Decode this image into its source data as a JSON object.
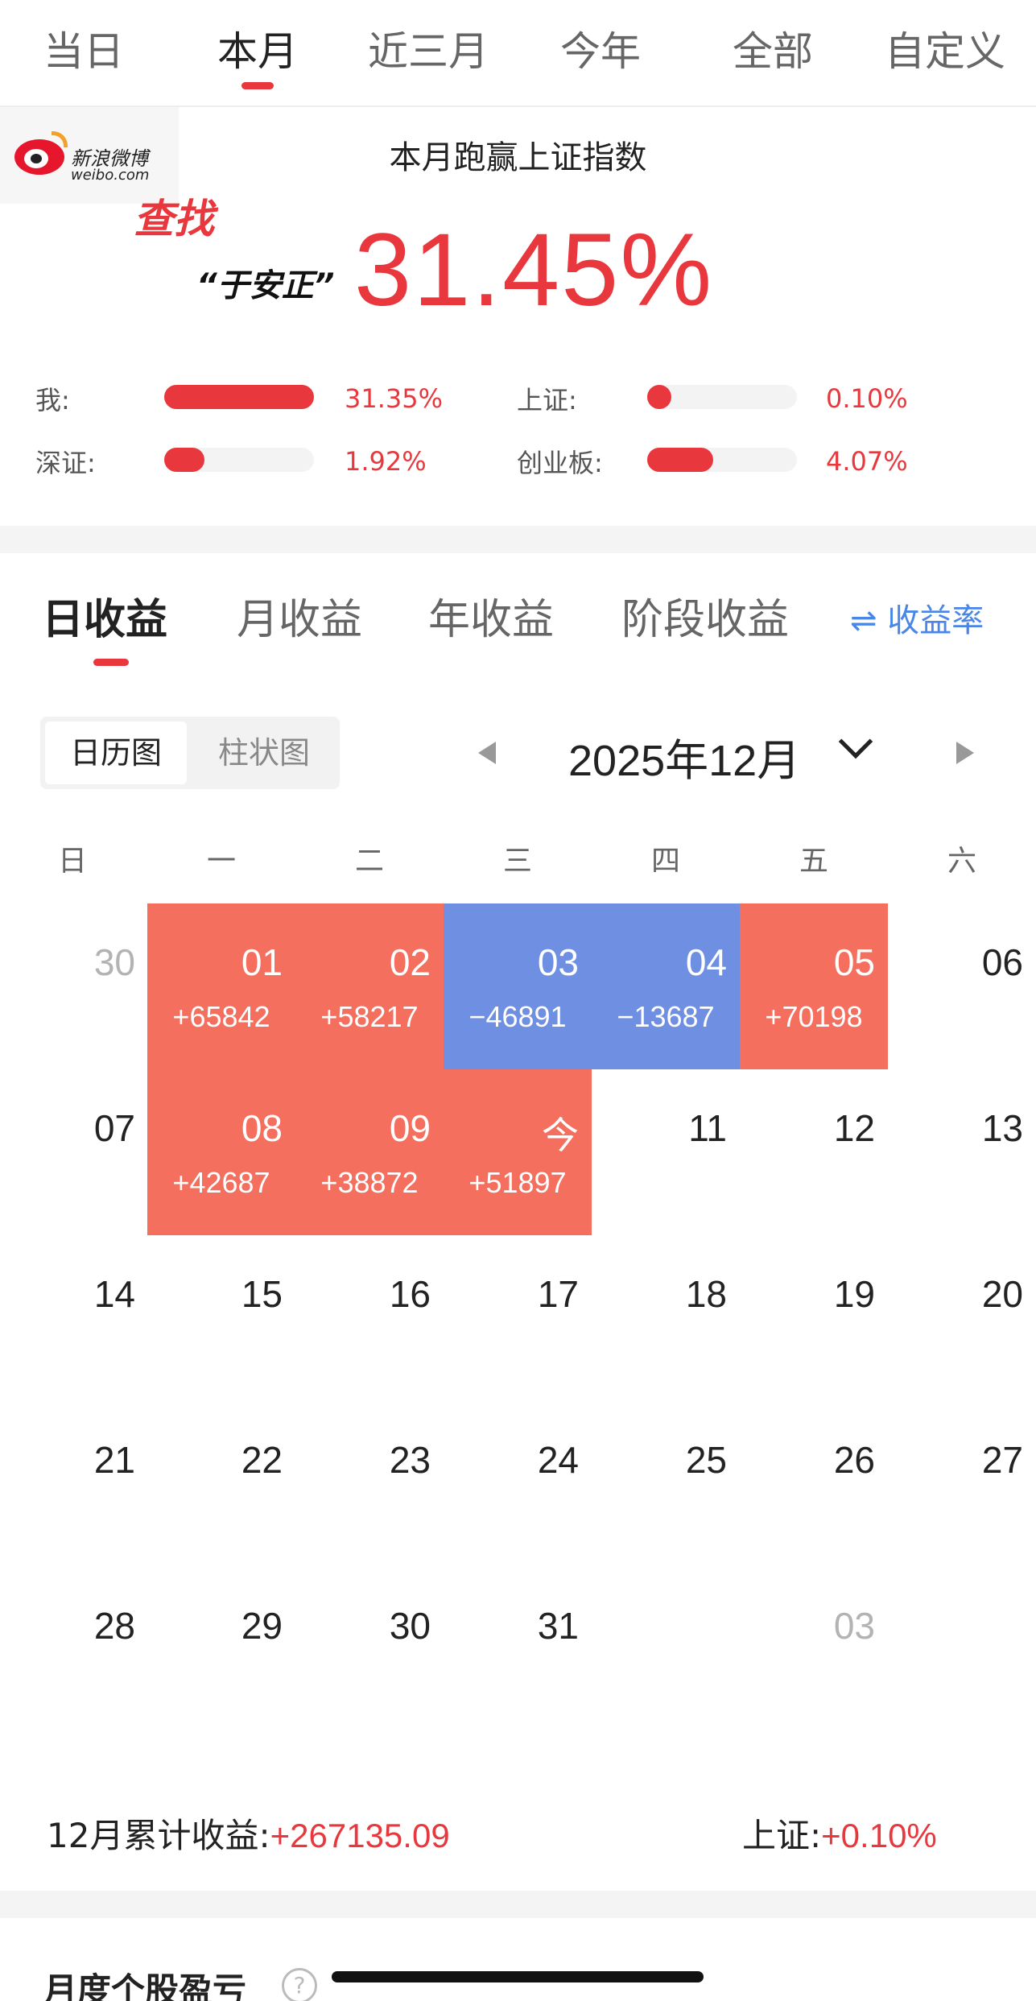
{
  "period_tabs": [
    {
      "label": "当日"
    },
    {
      "label": "本月"
    },
    {
      "label": "近三月"
    },
    {
      "label": "今年"
    },
    {
      "label": "全部"
    },
    {
      "label": "自定义"
    }
  ],
  "active_period": "本月",
  "watermark": {
    "cn": "新浪微博",
    "en": "weibo.com",
    "find": "查找",
    "name": "“于安正”"
  },
  "summary": {
    "title": "本月跑赢上证指数",
    "big_value": "31.45%",
    "stats": [
      {
        "label": "我:",
        "value": "31.35%",
        "fill": 1.0
      },
      {
        "label": "上证:",
        "value": "0.10%",
        "fill": 0.16
      },
      {
        "label": "深证:",
        "value": "1.92%",
        "fill": 0.27
      },
      {
        "label": "创业板:",
        "value": "4.07%",
        "fill": 0.44
      }
    ]
  },
  "return_tabs": {
    "items": [
      {
        "label": "日收益"
      },
      {
        "label": "月收益"
      },
      {
        "label": "年收益"
      },
      {
        "label": "阶段收益"
      }
    ],
    "active": "日收益",
    "rate_toggle": "⇌ 收益率"
  },
  "view_toggle": {
    "calendar": "日历图",
    "bar": "柱状图",
    "active": "calendar"
  },
  "month": {
    "title": "2025年12月"
  },
  "weekdays": [
    "日",
    "一",
    "二",
    "三",
    "四",
    "五",
    "六"
  ],
  "calendar": [
    [
      {
        "day": "30",
        "muted": true
      },
      {
        "day": "01",
        "amt": "+65842",
        "type": "pos"
      },
      {
        "day": "02",
        "amt": "+58217",
        "type": "pos"
      },
      {
        "day": "03",
        "amt": "−46891",
        "type": "neg"
      },
      {
        "day": "04",
        "amt": "−13687",
        "type": "neg"
      },
      {
        "day": "05",
        "amt": "+70198",
        "type": "pos"
      },
      {
        "day": "06"
      }
    ],
    [
      {
        "day": "07"
      },
      {
        "day": "08",
        "amt": "+42687",
        "type": "pos"
      },
      {
        "day": "09",
        "amt": "+38872",
        "type": "pos"
      },
      {
        "day": "今",
        "amt": "+51897",
        "type": "pos"
      },
      {
        "day": "11"
      },
      {
        "day": "12"
      },
      {
        "day": "13"
      }
    ],
    [
      {
        "day": "14"
      },
      {
        "day": "15"
      },
      {
        "day": "16"
      },
      {
        "day": "17"
      },
      {
        "day": "18"
      },
      {
        "day": "19"
      },
      {
        "day": "20"
      }
    ],
    [
      {
        "day": "21"
      },
      {
        "day": "22"
      },
      {
        "day": "23"
      },
      {
        "day": "24"
      },
      {
        "day": "25"
      },
      {
        "day": "26"
      },
      {
        "day": "27"
      }
    ],
    [
      {
        "day": "28"
      },
      {
        "day": "29"
      },
      {
        "day": "30"
      },
      {
        "day": "31"
      },
      {
        "day": ""
      },
      {
        "day": "03",
        "muted": true
      },
      {
        "day": ""
      }
    ]
  ],
  "footer": {
    "total_label": "12月累计收益:",
    "total_value": "+267135.09",
    "sh_label": "上证:",
    "sh_value": "+0.10%"
  },
  "section": {
    "title": "月度个股盈亏",
    "help": "?"
  },
  "colors": {
    "accent_red": "#e8383d",
    "gain_cell": "#f46f5e",
    "loss_cell": "#6f8fe3",
    "link_blue": "#4a86e8"
  }
}
